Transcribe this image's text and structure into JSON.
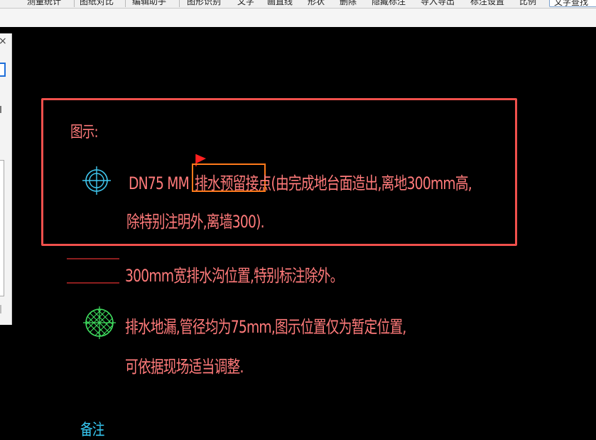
{
  "toolbar": {
    "items": [
      "测量统计",
      "图纸对比",
      "编辑助手",
      "图形识别",
      "文字",
      "画直线",
      "形状",
      "删除",
      "隐藏标注",
      "导入导出",
      "标注设置",
      "比例"
    ],
    "search_label": "文字查找"
  },
  "canvas": {
    "legend_heading": "图示:",
    "reserved_outlet": {
      "prefix": "DN75 MM",
      "highlighted": "排水预留接点",
      "suffix": "(由完成地台面造出,离地300mm高,",
      "line2": "除特别注明外,离墙300)."
    },
    "drain_trench": "300mm宽排水沟位置,特别标注除外。",
    "floor_drain": {
      "line1": "排水地漏,管径均为75mm,图示位置仅为暂定位置,",
      "line2": "可依据现场适当调整."
    },
    "notes_partial": "备注"
  },
  "colors": {
    "canvas_bg": "#000000",
    "cad_text": "#ff7a7a",
    "outlet_symbol": "#40c8f0",
    "drain_symbol": "#40e060",
    "selection_box": "#ff7a1a",
    "annotation_frame": "#f0504c",
    "marker_flag": "#ff2020",
    "trench_lines": "#e03030"
  },
  "icons": {
    "outlet": "circle-crosshair-icon",
    "drain": "hatched-circle-icon",
    "marker": "red-flag-icon",
    "panel_close": "close-icon"
  }
}
